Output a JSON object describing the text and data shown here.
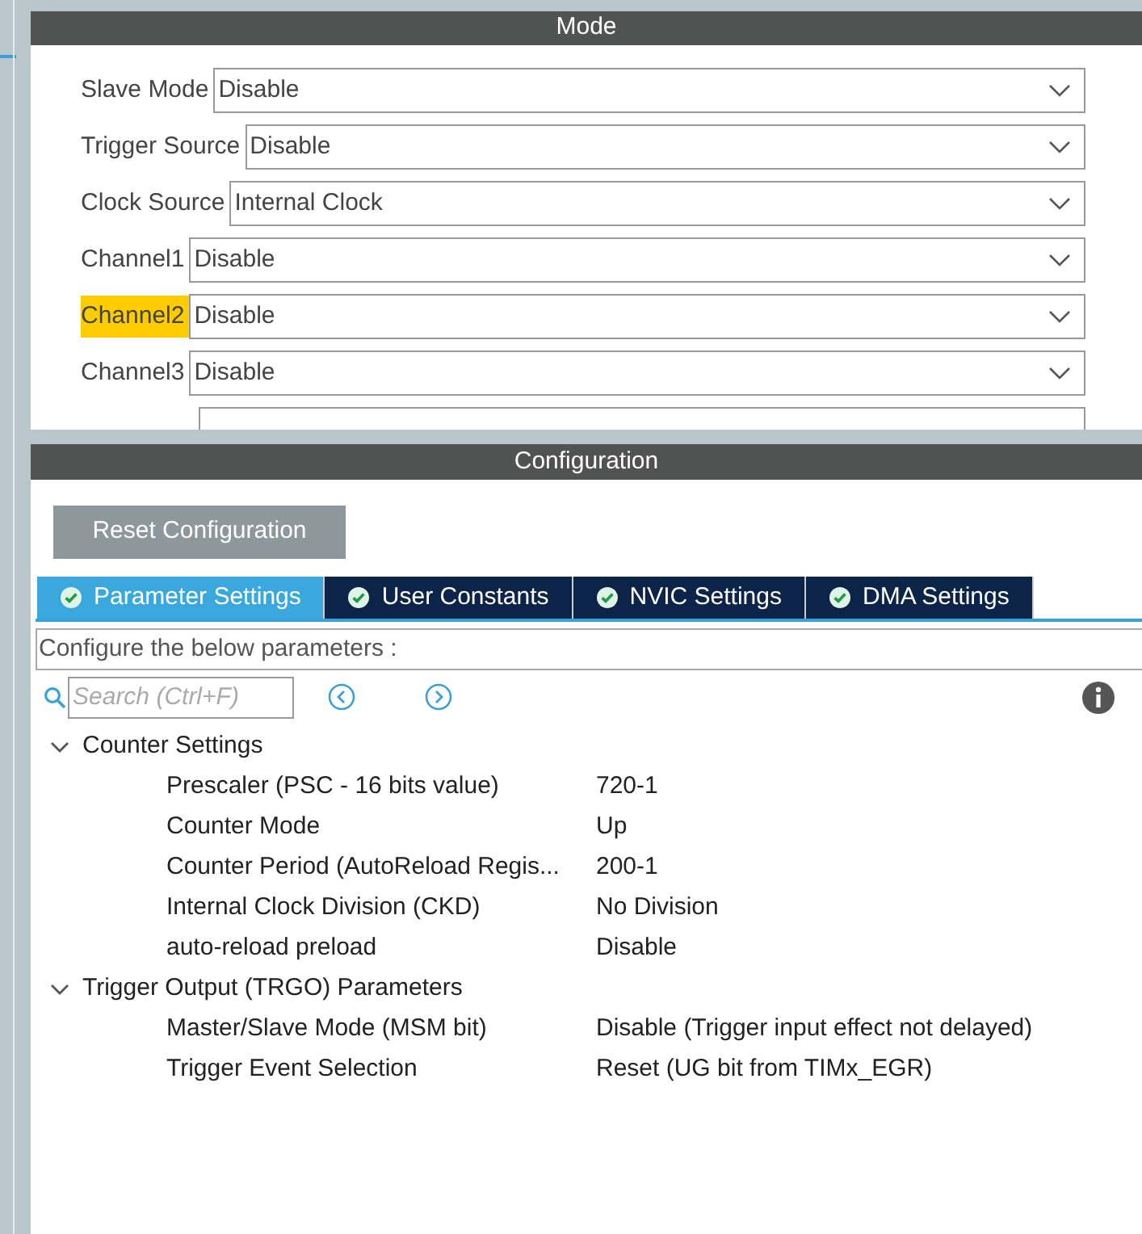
{
  "mode": {
    "title": "Mode",
    "fields": [
      {
        "label": "Slave Mode",
        "value": "Disable",
        "highlighted": false
      },
      {
        "label": "Trigger Source",
        "value": "Disable",
        "highlighted": false
      },
      {
        "label": "Clock Source",
        "value": "Internal Clock",
        "highlighted": false
      },
      {
        "label": "Channel1",
        "value": "Disable",
        "highlighted": false
      },
      {
        "label": "Channel2",
        "value": "Disable",
        "highlighted": true
      },
      {
        "label": "Channel3",
        "value": "Disable",
        "highlighted": false
      }
    ]
  },
  "configuration": {
    "title": "Configuration",
    "reset_button": "Reset Configuration",
    "tabs": [
      {
        "label": "Parameter Settings",
        "selected": true
      },
      {
        "label": "User Constants",
        "selected": false
      },
      {
        "label": "NVIC Settings",
        "selected": false
      },
      {
        "label": "DMA Settings",
        "selected": false
      }
    ],
    "hint": "Configure the below parameters :",
    "search": {
      "placeholder": "Search (Ctrl+F)"
    },
    "groups": [
      {
        "label": "Counter Settings",
        "expanded": true,
        "children": [
          {
            "name": "Prescaler (PSC - 16 bits value)",
            "value": "720-1"
          },
          {
            "name": "Counter Mode",
            "value": "Up"
          },
          {
            "name": "Counter Period (AutoReload Regis...",
            "value": "200-1"
          },
          {
            "name": "Internal Clock Division (CKD)",
            "value": "No Division"
          },
          {
            "name": "auto-reload preload",
            "value": "Disable"
          }
        ]
      },
      {
        "label": "Trigger Output (TRGO) Parameters",
        "expanded": true,
        "children": [
          {
            "name": "Master/Slave Mode (MSM bit)",
            "value": "Disable (Trigger input effect not delayed)"
          },
          {
            "name": "Trigger Event Selection",
            "value": "Reset (UG bit from TIMx_EGR)"
          }
        ]
      }
    ]
  }
}
